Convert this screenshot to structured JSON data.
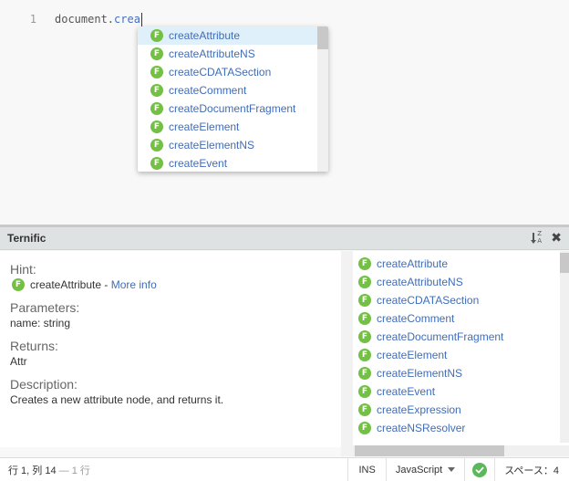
{
  "editor": {
    "line_number": "1",
    "code_prefix": "document.",
    "code_typed": "crea"
  },
  "code_hints": {
    "icon_letter": "F",
    "items": [
      "createAttribute",
      "createAttributeNS",
      "createCDATASection",
      "createComment",
      "createDocumentFragment",
      "createElement",
      "createElementNS",
      "createEvent"
    ],
    "selected_index": 0
  },
  "panel": {
    "title": "Ternific",
    "hint_label": "Hint:",
    "hint_name": "createAttribute",
    "hint_separator": " - ",
    "more_info": "More info",
    "parameters_label": "Parameters:",
    "parameters_value": "name: string",
    "returns_label": "Returns:",
    "returns_value": "Attr",
    "description_label": "Description:",
    "description_value": "Creates a new attribute node, and returns it.",
    "list_items": [
      "createAttribute",
      "createAttributeNS",
      "createCDATASection",
      "createComment",
      "createDocumentFragment",
      "createElement",
      "createElementNS",
      "createEvent",
      "createExpression",
      "createNSResolver"
    ]
  },
  "statusbar": {
    "cursor_pos": "行 1, 列 14",
    "line_count": " — 1 行",
    "ins": "INS",
    "language": "JavaScript",
    "indent": "スペース：4"
  },
  "colors": {
    "fn_icon": "#74c045",
    "hint_text": "#3f6dbb",
    "selected_bg": "#e0f0fa",
    "lint_ok": "#5cb85c"
  }
}
